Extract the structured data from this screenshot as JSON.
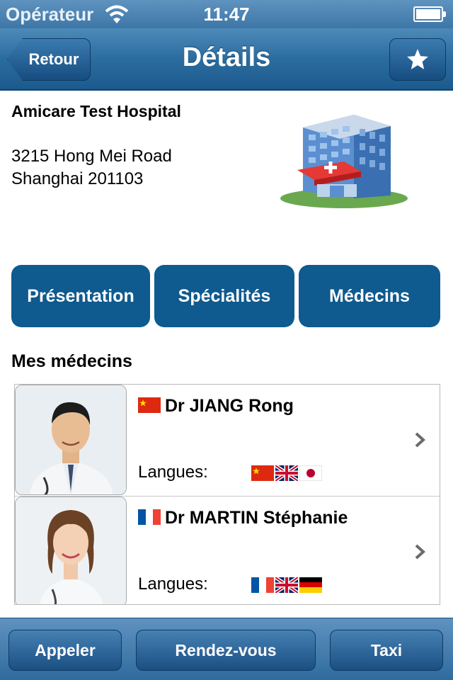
{
  "status_bar": {
    "carrier": "Opérateur",
    "time": "11:47"
  },
  "nav": {
    "back_label": "Retour",
    "title": "Détails",
    "favorite_icon": "star-icon"
  },
  "hospital": {
    "name": "Amicare Test Hospital",
    "address_line1": "3215 Hong Mei Road",
    "address_line2": "Shanghai 201103"
  },
  "tabs": [
    {
      "label": "Présentation"
    },
    {
      "label": "Spécialités"
    },
    {
      "label": "Médecins"
    }
  ],
  "doctors_section": {
    "title": "Mes médecins"
  },
  "doctors": [
    {
      "name": "Dr JIANG Rong",
      "flag": "china-flag",
      "languages_label": "Langues:",
      "languages": [
        "china-flag",
        "uk-flag",
        "japan-flag"
      ]
    },
    {
      "name": "Dr MARTIN Stéphanie",
      "flag": "france-flag",
      "languages_label": "Langues:",
      "languages": [
        "france-flag",
        "uk-flag",
        "germany-flag"
      ]
    }
  ],
  "toolbar": {
    "call_label": "Appeler",
    "appointment_label": "Rendez-vous",
    "taxi_label": "Taxi"
  },
  "colors": {
    "accent": "#0f5a8e",
    "nav_top": "#4d8ab9",
    "nav_bottom": "#1c5a8d"
  }
}
